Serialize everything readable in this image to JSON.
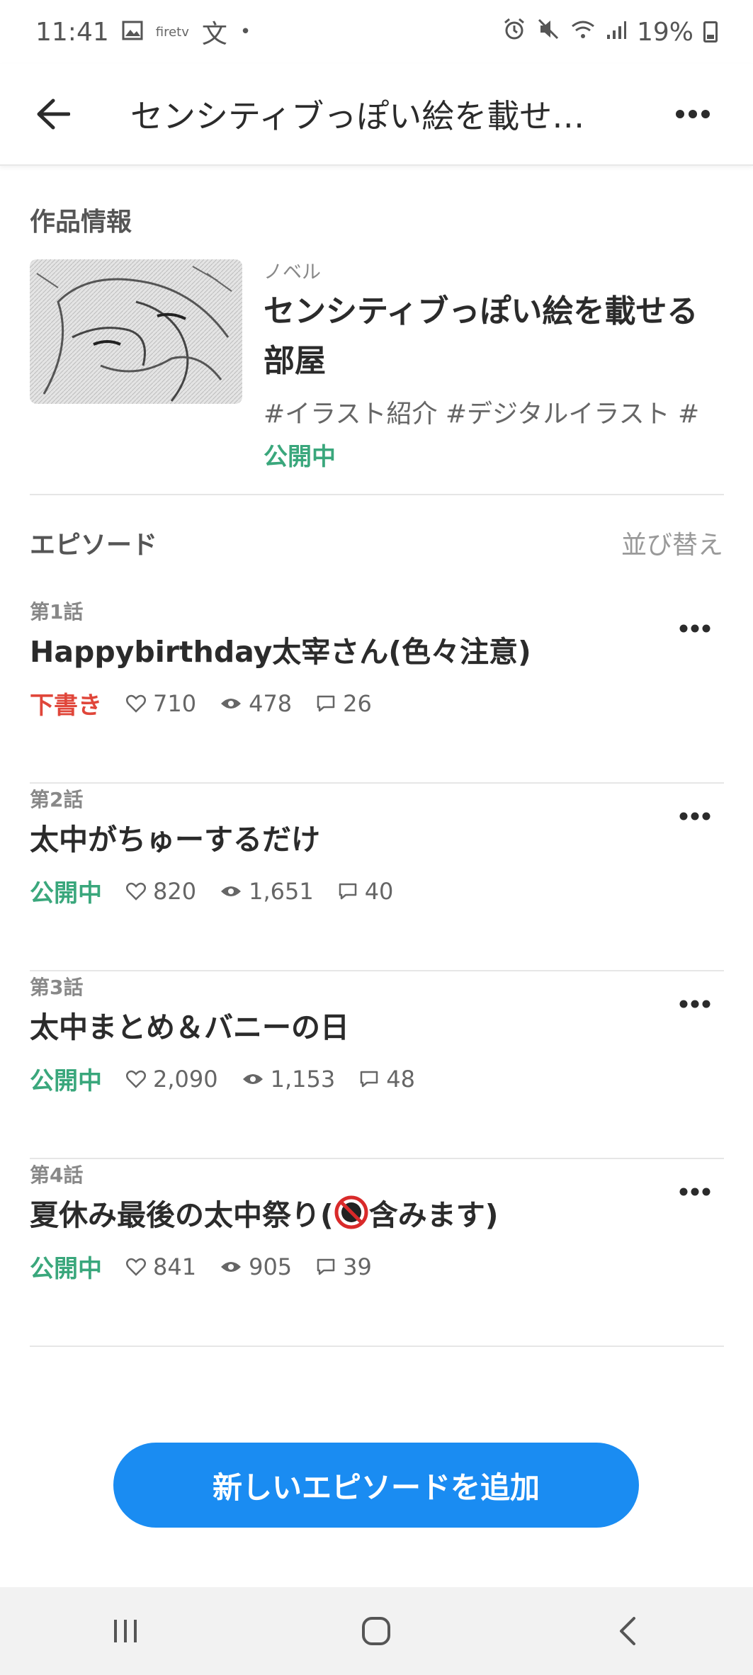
{
  "status_bar": {
    "time": "11:41",
    "firetv": "firetv",
    "lang_glyph": "文",
    "dot": "•",
    "battery": "19%",
    "icons": [
      "image-icon",
      "alarm-icon",
      "mute-icon",
      "wifi-icon",
      "signal-icon",
      "battery-icon"
    ]
  },
  "app_bar": {
    "title": "センシティブっぽい絵を載せる部屋"
  },
  "work_section": {
    "heading": "作品情報",
    "type": "ノベル",
    "title": "センシティブっぽい絵を載せる部屋",
    "tags": "#イラスト紹介 #デジタルイラスト #",
    "status": "公開中"
  },
  "episodes_section": {
    "heading": "エピソード",
    "sort_label": "並び替え",
    "items": [
      {
        "number": "第1話",
        "title": "Happybirthday太宰さん(色々注意)",
        "status": "下書き",
        "status_type": "draft",
        "likes": "710",
        "views": "478",
        "comments": "26"
      },
      {
        "number": "第2話",
        "title": "太中がちゅーするだけ",
        "status": "公開中",
        "status_type": "public",
        "likes": "820",
        "views": "1,651",
        "comments": "40"
      },
      {
        "number": "第3話",
        "title": "太中まとめ＆バニーの日",
        "status": "公開中",
        "status_type": "public",
        "likes": "2,090",
        "views": "1,153",
        "comments": "48"
      },
      {
        "number": "第4話",
        "title_before": "夏休み最後の太中祭り(",
        "title_after": "含みます)",
        "status": "公開中",
        "status_type": "public",
        "likes": "841",
        "views": "905",
        "comments": "39"
      }
    ]
  },
  "add_button_label": "新しいエピソードを追加",
  "colors": {
    "accent": "#1a8cf2",
    "public": "#3aa77c",
    "draft": "#e0463a"
  }
}
